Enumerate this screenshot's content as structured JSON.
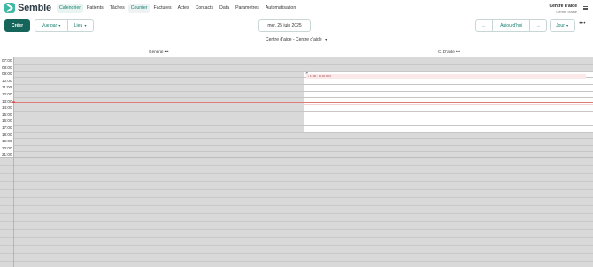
{
  "app": {
    "brand": "Semble"
  },
  "nav": {
    "items": [
      {
        "label": "Calendrier",
        "state": "active"
      },
      {
        "label": "Patients",
        "state": ""
      },
      {
        "label": "Tâches",
        "state": ""
      },
      {
        "label": "Courrier",
        "state": "hl"
      },
      {
        "label": "Factures",
        "state": ""
      },
      {
        "label": "Actes",
        "state": ""
      },
      {
        "label": "Contacts",
        "state": ""
      },
      {
        "label": "Data",
        "state": ""
      },
      {
        "label": "Paramètres",
        "state": ""
      },
      {
        "label": "Automatisation",
        "state": ""
      }
    ]
  },
  "account": {
    "name": "Centre d'aide",
    "subtitle": "Centre d'aide"
  },
  "toolbar": {
    "create": "Créer",
    "view_by": "Vue par",
    "location": "Lieu",
    "date": "mer. 25 juin 2025",
    "prev": "←",
    "today": "Aujourd'hui",
    "next": "→",
    "period": "Jour",
    "more": "•••"
  },
  "calendar": {
    "resource_title": "Centre d'aide - Centre d'aide",
    "columns": [
      {
        "title": "Général",
        "more": "•••"
      },
      {
        "title": "C. D'aide",
        "more": "•••"
      }
    ],
    "hours": [
      "07:00",
      "08:00",
      "09:00",
      "10:00",
      "11:00",
      "12:00",
      "13:00",
      "14:00",
      "15:00",
      "16:00",
      "17:00",
      "18:00",
      "19:00",
      "20:00",
      "21:00"
    ],
    "event": {
      "label": "• 11:00 - 11:30 RDV"
    },
    "colors": {
      "accent": "#16655a",
      "now": "#e04c4c",
      "closed": "#d9d9d9"
    }
  }
}
